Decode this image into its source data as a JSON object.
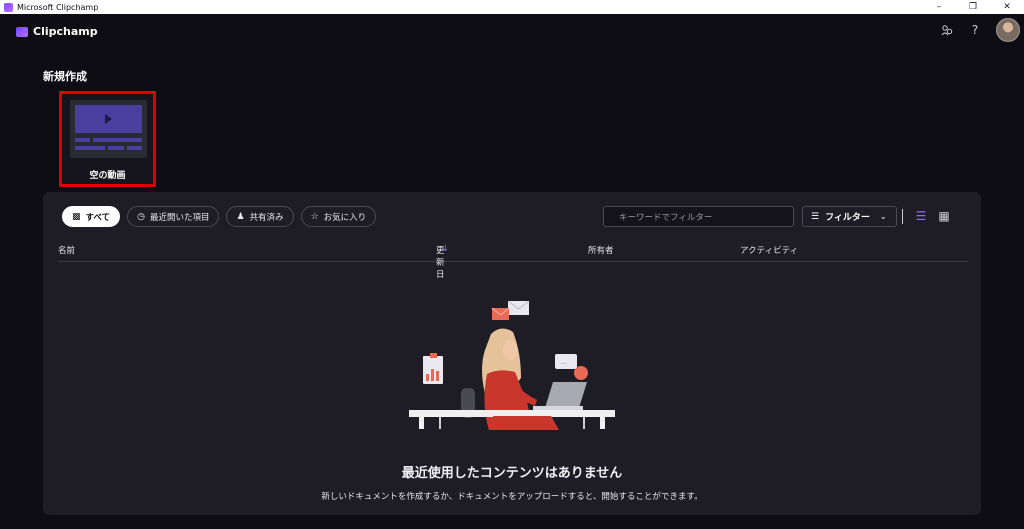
{
  "window": {
    "title": "Microsoft Clipchamp",
    "controls": [
      "minimize-icon",
      "restore-icon",
      "close-icon"
    ]
  },
  "header": {
    "brand": "Clipchamp",
    "icons": [
      "share-icon",
      "help-icon"
    ],
    "help_glyph": "?"
  },
  "new_section": {
    "title": "新規作成",
    "card_label": "空の動画"
  },
  "filters": {
    "chips": [
      {
        "label": "すべて",
        "icon": "cube-icon",
        "active": true
      },
      {
        "label": "最近開いた項目",
        "icon": "clock-icon",
        "active": false
      },
      {
        "label": "共有済み",
        "icon": "people-icon",
        "active": false
      },
      {
        "label": "お気に入り",
        "icon": "star-icon",
        "active": false
      }
    ],
    "search_placeholder": "キーワードでフィルター",
    "filter_button": "フィルター"
  },
  "table": {
    "columns": [
      "名前",
      "更新日",
      "所有者",
      "アクティビティ"
    ],
    "sort_glyph": "↓"
  },
  "empty_state": {
    "title": "最近使用したコンテンツはありません",
    "subtitle": "新しいドキュメントを作成するか、ドキュメントをアップロードすると、開始することができます。"
  },
  "colors": {
    "accent": "#8a6cff",
    "highlight_border": "#e00000",
    "background": "#0e0d14",
    "panel": "#1e1d26"
  }
}
